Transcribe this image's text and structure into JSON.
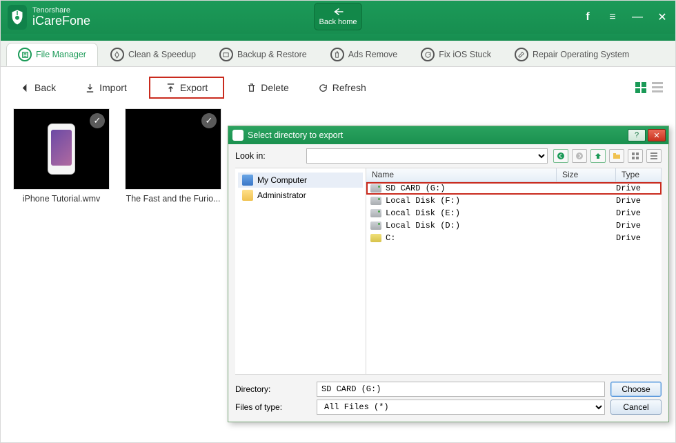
{
  "brand": {
    "small": "Tenorshare",
    "name": "iCareFone"
  },
  "back_home": "Back home",
  "title_controls": {
    "facebook": "f",
    "menu": "≡",
    "min": "—",
    "close": "✕"
  },
  "tabs": [
    {
      "label": "File Manager",
      "active": true
    },
    {
      "label": "Clean & Speedup"
    },
    {
      "label": "Backup & Restore"
    },
    {
      "label": "Ads Remove"
    },
    {
      "label": "Fix iOS Stuck"
    },
    {
      "label": "Repair Operating System"
    }
  ],
  "toolbar": {
    "back": "Back",
    "import": "Import",
    "export": "Export",
    "delete": "Delete",
    "refresh": "Refresh"
  },
  "thumbs": [
    {
      "caption": "iPhone Tutorial.wmv"
    },
    {
      "caption": "The Fast and the Furio..."
    }
  ],
  "dialog": {
    "title": "Select directory to export",
    "look_in_label": "Look in:",
    "look_in_value": "",
    "tree": [
      {
        "label": "My Computer",
        "icon": "pc",
        "selected": true
      },
      {
        "label": "Administrator",
        "icon": "folder"
      }
    ],
    "columns": {
      "name": "Name",
      "size": "Size",
      "type": "Type"
    },
    "rows": [
      {
        "name": "SD CARD (G:)",
        "size": "",
        "type": "Drive",
        "icon": "drive",
        "selected": true
      },
      {
        "name": "Local Disk (F:)",
        "size": "",
        "type": "Drive",
        "icon": "drive"
      },
      {
        "name": "Local Disk (E:)",
        "size": "",
        "type": "Drive",
        "icon": "drive"
      },
      {
        "name": "Local Disk (D:)",
        "size": "",
        "type": "Drive",
        "icon": "drive"
      },
      {
        "name": "C:",
        "size": "",
        "type": "Drive",
        "icon": "c"
      }
    ],
    "directory_label": "Directory:",
    "directory_value": "SD CARD (G:)",
    "filetype_label": "Files of type:",
    "filetype_value": "All Files (*)",
    "choose": "Choose",
    "cancel": "Cancel"
  }
}
